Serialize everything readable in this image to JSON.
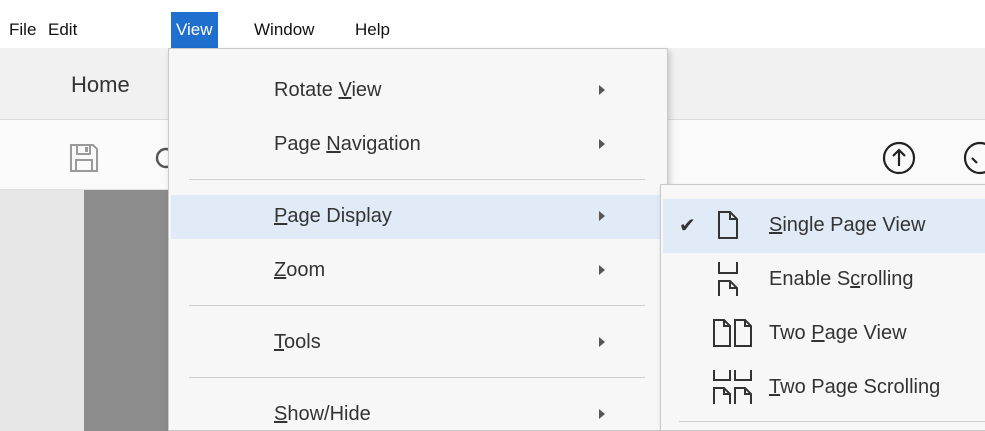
{
  "menubar": {
    "items": [
      {
        "label": "File"
      },
      {
        "label": "Edit"
      },
      {
        "label": "View"
      },
      {
        "label": "Window"
      },
      {
        "label": "Help"
      }
    ]
  },
  "app": {
    "tab_home": "Home"
  },
  "view_menu": {
    "items": [
      {
        "pre": "Rotate ",
        "key": "V",
        "post": "iew"
      },
      {
        "pre": "Page ",
        "key": "N",
        "post": "avigation"
      },
      {
        "pre": "",
        "key": "P",
        "post": "age Display"
      },
      {
        "pre": "",
        "key": "Z",
        "post": "oom"
      },
      {
        "pre": "",
        "key": "T",
        "post": "ools"
      },
      {
        "pre": "",
        "key": "S",
        "post": "how/Hide"
      }
    ]
  },
  "page_display_submenu": {
    "items": [
      {
        "pre": "",
        "key": "S",
        "post": "ingle Page View",
        "checked": true,
        "icon": "single-page-icon"
      },
      {
        "pre": "Enable S",
        "key": "c",
        "post": "rolling",
        "checked": false,
        "icon": "scrolling-icon"
      },
      {
        "pre": "Two ",
        "key": "P",
        "post": "age View",
        "checked": false,
        "icon": "two-page-icon"
      },
      {
        "pre": "",
        "key": "T",
        "post": "wo Page Scrolling",
        "checked": false,
        "icon": "two-page-scrolling-icon"
      }
    ],
    "check_glyph": "✔"
  },
  "colors": {
    "menu_active": "#1f6fcf",
    "highlight": "#e0ebf7"
  }
}
